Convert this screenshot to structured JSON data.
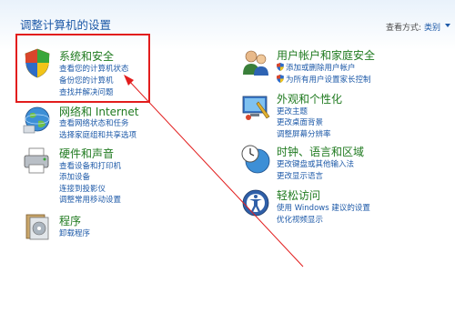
{
  "header": {
    "title": "调整计算机的设置",
    "view_label": "查看方式:",
    "view_value": "类别"
  },
  "categories": [
    {
      "title": "系统和安全",
      "links": [
        "查看您的计算机状态",
        "备份您的计算机",
        "查找并解决问题"
      ]
    },
    {
      "title": "网络和 Internet",
      "links": [
        "查看网络状态和任务",
        "选择家庭组和共享选项"
      ]
    },
    {
      "title": "硬件和声音",
      "links": [
        "查看设备和打印机",
        "添加设备",
        "连接到投影仪",
        "调整常用移动设置"
      ]
    },
    {
      "title": "程序",
      "links": [
        "卸载程序"
      ]
    },
    {
      "title": "用户帐户和家庭安全",
      "links": [
        "添加或删除用户帐户",
        "为所有用户设置家长控制"
      ]
    },
    {
      "title": "外观和个性化",
      "links": [
        "更改主题",
        "更改桌面背景",
        "调整屏幕分辨率"
      ]
    },
    {
      "title": "时钟、语言和区域",
      "links": [
        "更改键盘或其他输入法",
        "更改显示语言"
      ]
    },
    {
      "title": "轻松访问",
      "links": [
        "使用 Windows 建议的设置",
        "优化视频显示"
      ]
    }
  ],
  "annotation": {
    "color": "#e21d1d"
  }
}
